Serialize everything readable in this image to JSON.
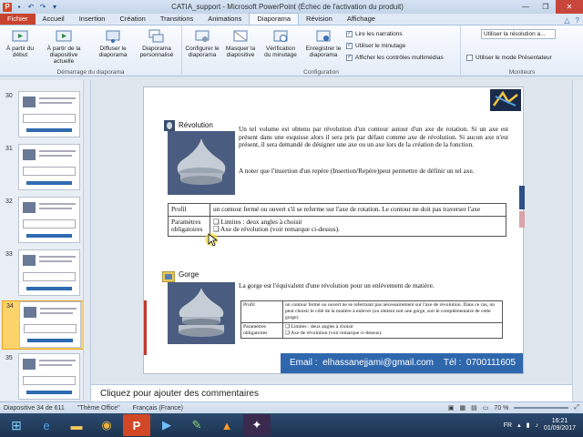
{
  "window": {
    "title": "CATIA_support - Microsoft PowerPoint (Échec de l'activation du produit)",
    "app_icon": "P"
  },
  "ribbon_tabs": [
    "Fichier",
    "Accueil",
    "Insertion",
    "Création",
    "Transitions",
    "Animations",
    "Diaporama",
    "Révision",
    "Affichage"
  ],
  "ribbon": {
    "start_group": {
      "btn1": "À partir du début",
      "btn2": "À partir de la diapositive actuelle",
      "btn3": "Diffuser le diaporama",
      "btn4": "Diaporama personnalisé",
      "label": "Démarrage du diaporama"
    },
    "config_group": {
      "btn1": "Configurer le diaporama",
      "btn2": "Masquer la diapositive",
      "btn3": "Vérification du minutage",
      "btn4": "Enregistrer le diaporama",
      "chk1": "Lire les narrations",
      "chk2": "Utiliser le minutage",
      "chk3": "Afficher les contrôles multimédias",
      "label": "Configuration"
    },
    "monitor_group": {
      "resolution": "Utiliser la résolution a...",
      "presenter": "Utiliser le mode Présentateur",
      "label": "Moniteurs"
    }
  },
  "thumbnails": [
    "30",
    "31",
    "32",
    "33",
    "34",
    "35"
  ],
  "selected_slide": "34",
  "slide": {
    "section1_title": "Révolution",
    "section1_p1": "Un tel volume est obtenu par révolution d'un contour autour d'un axe de rotation. Si un axe est présent dans une esquisse alors il sera pris par défaut comme axe de révolution. Si aucun axe n'est présent, il sera demandé de désigner une axe ou un axe lors de la création de la fonction.",
    "section1_p2": "A noter que l'insertion d'un repère (Insertion/Repère)peut permettre de définir un tel axe.",
    "table1": {
      "r1c1": "Profil",
      "r1c2": "un contour fermé ou ouvert s'il se referme sur l'axe de rotation. Le contour ne doit pas traverser l'axe",
      "r2c1": "Paramètres obligatoires",
      "r2c2a": "Limites : deux angles à choisir",
      "r2c2b": "Axe de révolution (voir remarque ci-dessus)."
    },
    "section2_title": "Gorge",
    "section2_p1": "La gorge est l'équivalent d'une révolution pour un enlèvement de matière.",
    "table2": {
      "r1c1": "Profil",
      "r1c2": "un contour fermé ou ouvert ne se refermant pas nécessairement sur l'axe de révolution. Dans ce cas, on peut choisir le côté de la matière à enlever (on obtient soit une gorge, soit le complémentaire de cette gorge)",
      "r2c1": "Paramètres obligatoires",
      "r2c2a": "Limites : deux angles à choisir",
      "r2c2b": "Axe de révolution (voir remarque ci-dessus)."
    },
    "footer": "Email :  elhassanejjami@gmail.com    Tél :  0700111605"
  },
  "notes_placeholder": "Cliquez pour ajouter des commentaires",
  "statusbar": {
    "slide_info": "Diapositive 34 de 611",
    "theme": "\"Thème Office\"",
    "language": "Français (France)",
    "zoom": "70 %"
  },
  "taskbar": {
    "language": "FR",
    "time": "16:21",
    "date": "01/09/2017"
  },
  "colors": {
    "accent": "#2f67ad",
    "file_tab": "#c8432e",
    "selected_thumb": "#fbd36b"
  }
}
